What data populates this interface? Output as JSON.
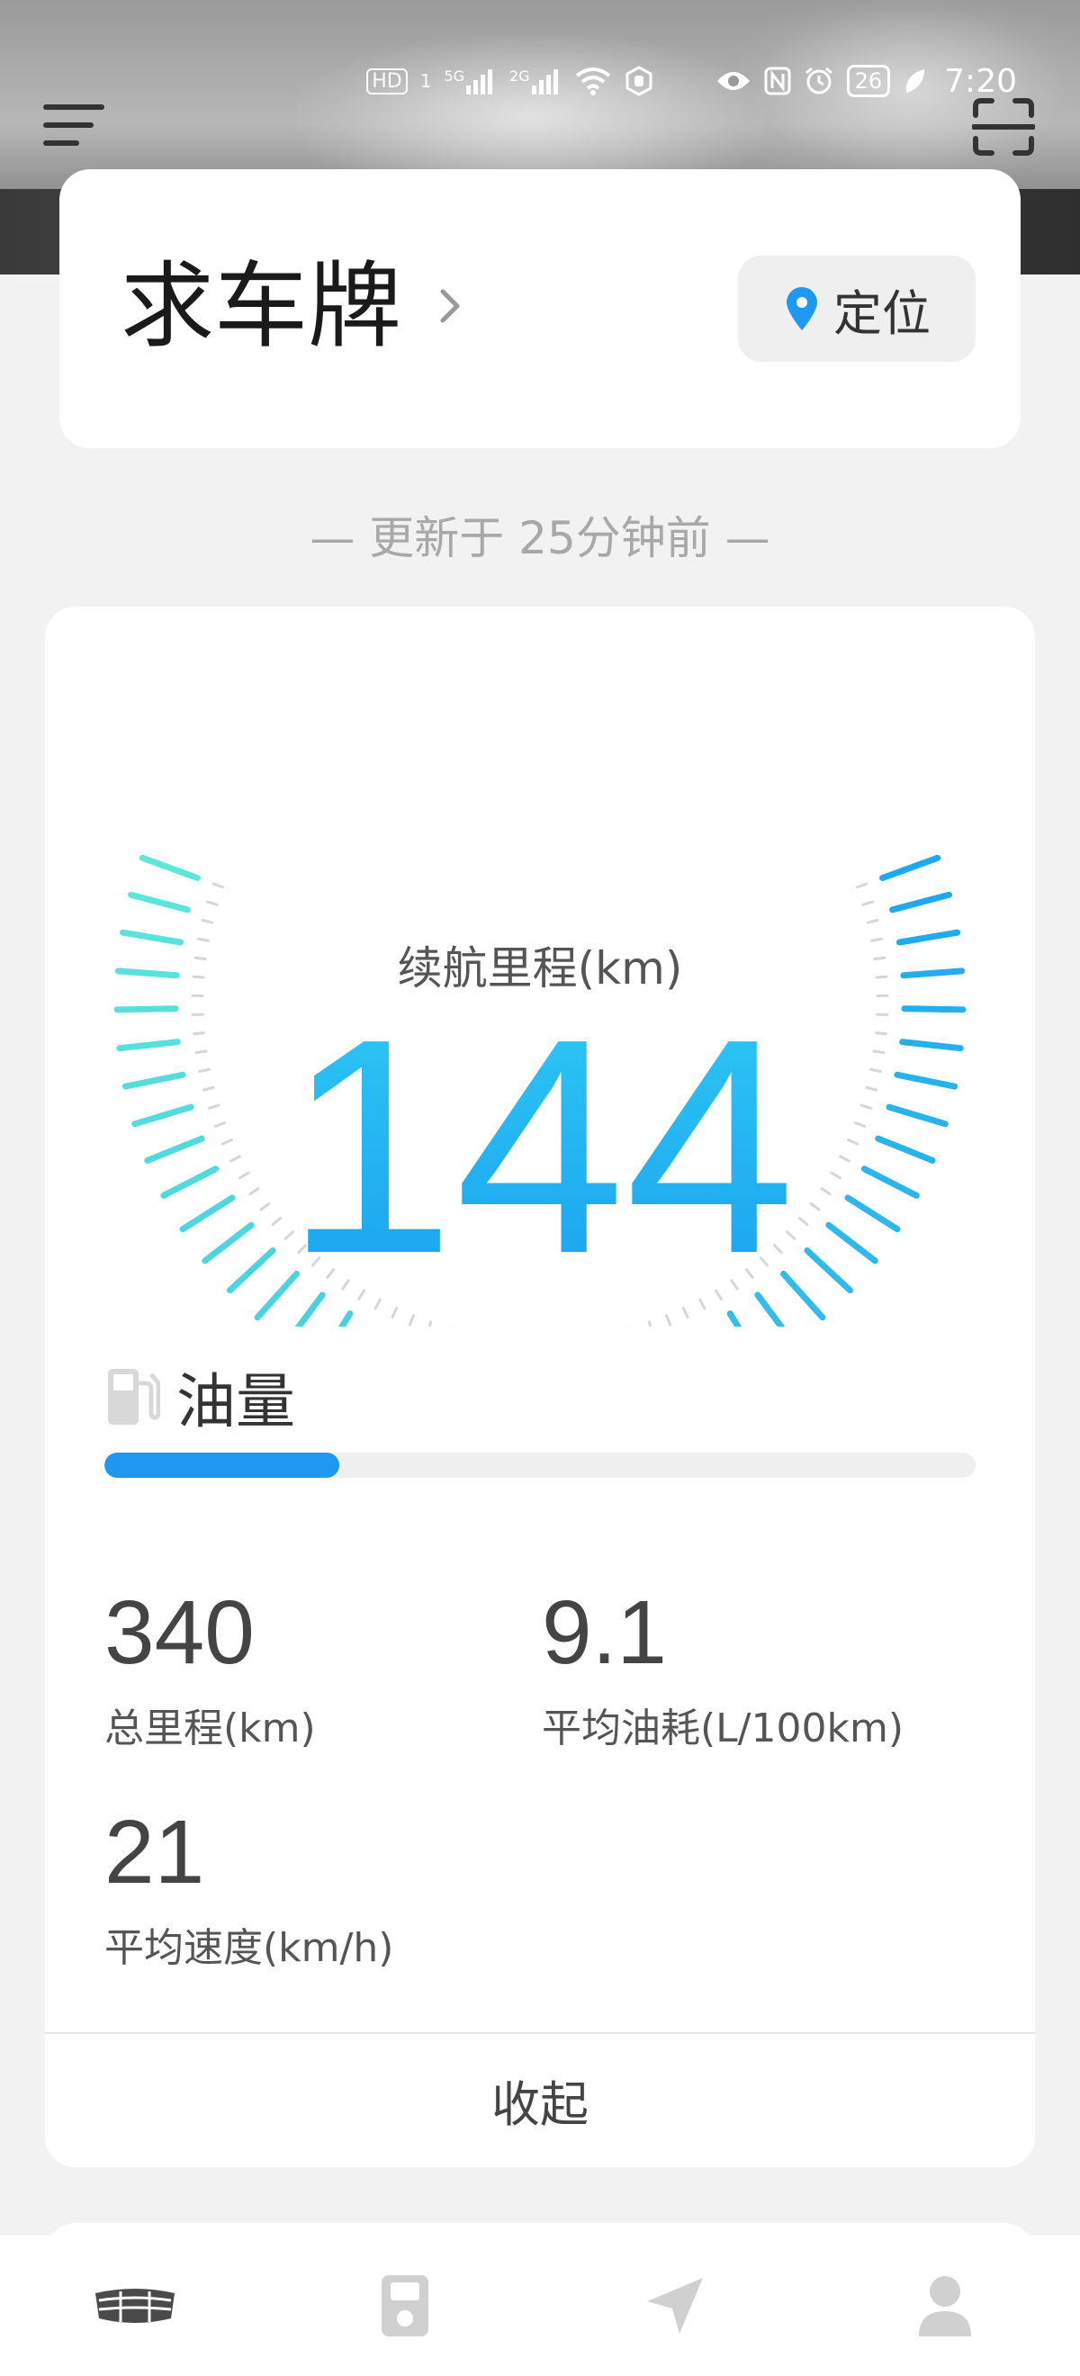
{
  "status_bar": {
    "hd_label": "HD",
    "sim1_label": "1",
    "net1_label": "5G",
    "net2_label": "2G",
    "battery_level": "26",
    "time": "7:20"
  },
  "header": {
    "menu_icon": "hamburger-menu-icon",
    "scan_icon": "scan-icon"
  },
  "vehicle": {
    "plate": "求车牌",
    "locate_label": "定位",
    "locate_icon": "location-pin-icon",
    "accent_color": "#1e98f0"
  },
  "update": {
    "text": "— 更新于 25分钟前 —"
  },
  "dashboard": {
    "range_label": "续航里程(km)",
    "range_value": "144",
    "fuel_label": "油量",
    "fuel_icon": "fuel-pump-icon",
    "fuel_level": 0.27,
    "stats": [
      {
        "value": "340",
        "label": "总里程(km)"
      },
      {
        "value": "9.1",
        "label": "平均油耗(L/100km)"
      },
      {
        "value": "21",
        "label": "平均速度(km/h)"
      }
    ],
    "collapse_label": "收起"
  },
  "bottom_nav": [
    {
      "icon": "car-brand-icon",
      "active": true
    },
    {
      "icon": "device-icon",
      "active": false
    },
    {
      "icon": "navigation-arrow-icon",
      "active": false
    },
    {
      "icon": "user-icon",
      "active": false
    }
  ]
}
